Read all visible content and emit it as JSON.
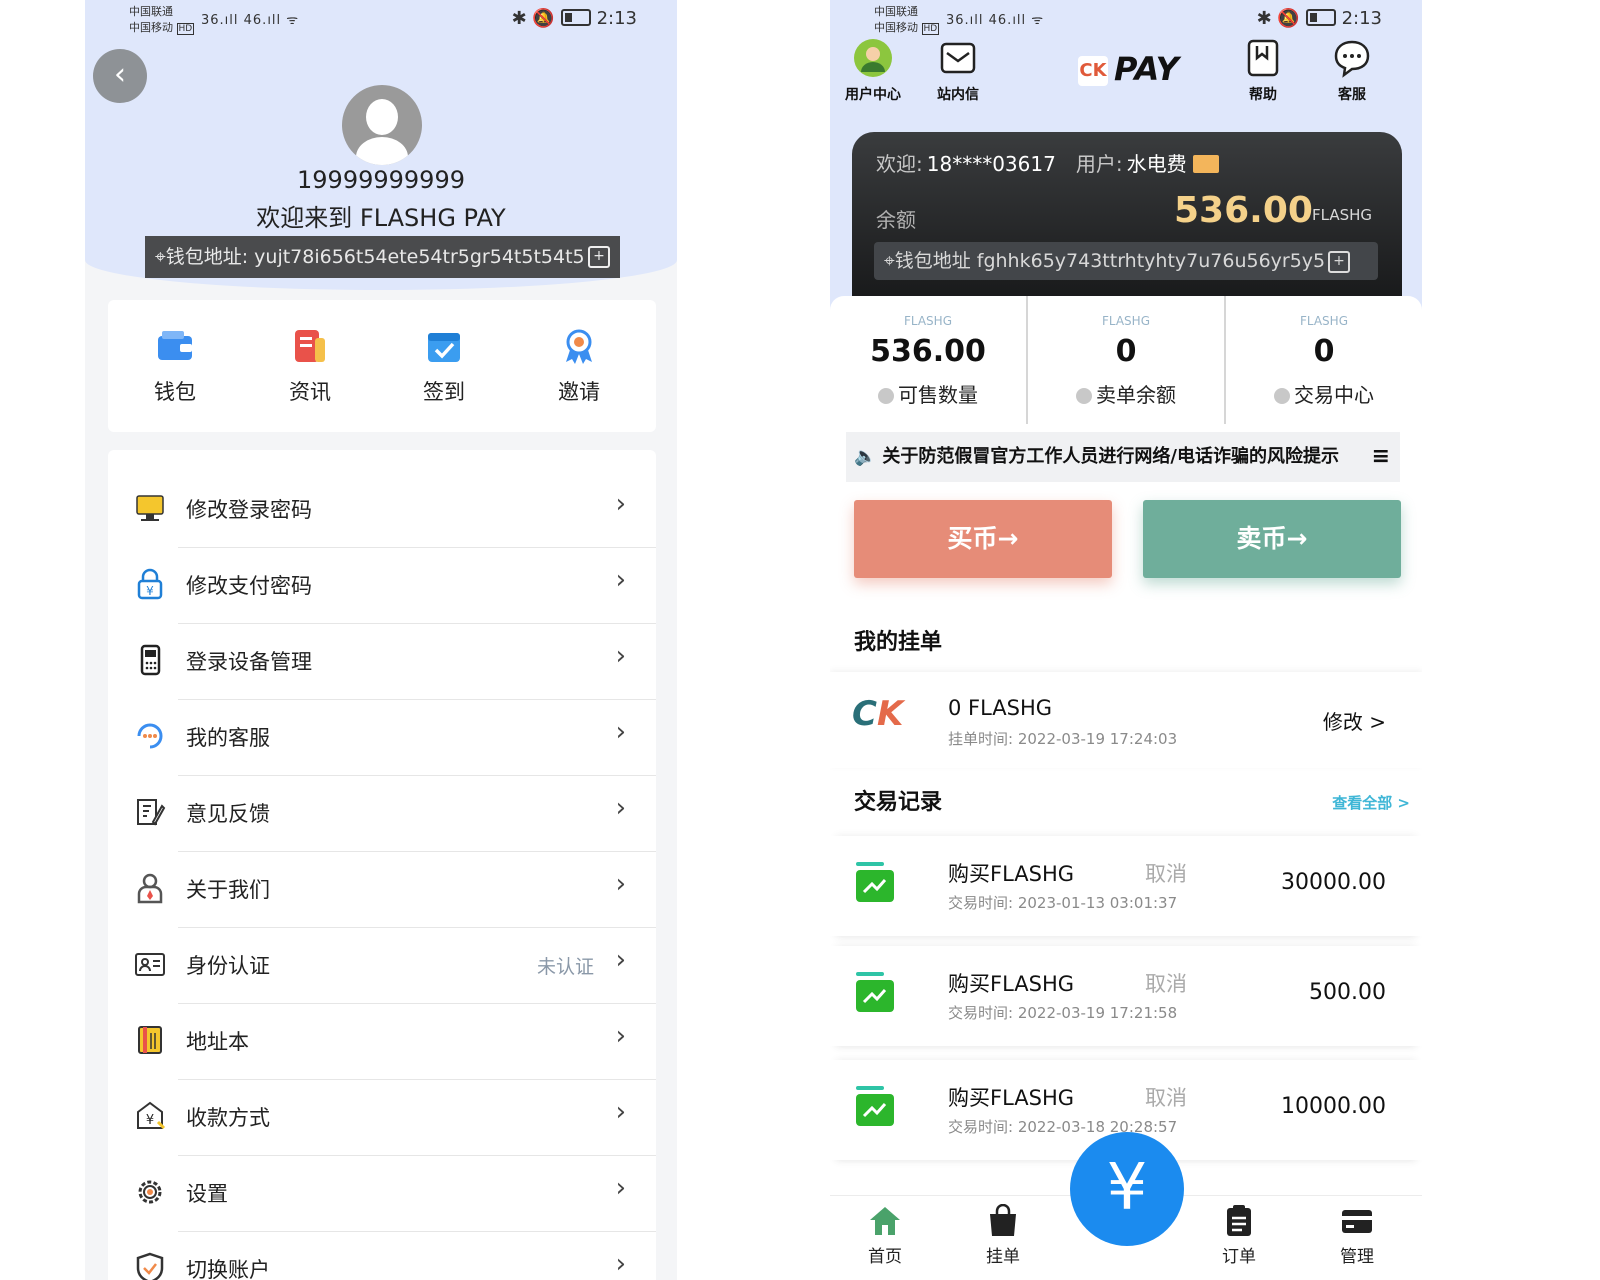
{
  "status_bar": {
    "carrier1": "中国联通",
    "carrier2": "中国移动",
    "hd": "HD",
    "signal": "36.ıll 46.ıll ᯤ",
    "time": "2:13"
  },
  "profile": {
    "phone": "19999999999",
    "welcome": "欢迎来到 FLASHG PAY",
    "wallet_label": "钱包地址:",
    "wallet_address": "yujt78i656t54ete54tr5gr54t5t54t5"
  },
  "quick_actions": [
    {
      "label": "钱包",
      "icon": "wallet-icon"
    },
    {
      "label": "资讯",
      "icon": "news-icon"
    },
    {
      "label": "签到",
      "icon": "checkin-icon"
    },
    {
      "label": "邀请",
      "icon": "invite-icon"
    }
  ],
  "menu": [
    {
      "label": "修改登录密码",
      "icon": "login-password-icon"
    },
    {
      "label": "修改支付密码",
      "icon": "pay-password-icon"
    },
    {
      "label": "登录设备管理",
      "icon": "device-icon"
    },
    {
      "label": "我的客服",
      "icon": "customer-service-icon"
    },
    {
      "label": "意见反馈",
      "icon": "feedback-icon"
    },
    {
      "label": "关于我们",
      "icon": "about-icon"
    },
    {
      "label": "身份认证",
      "icon": "id-card-icon",
      "extra": "未认证"
    },
    {
      "label": "地址本",
      "icon": "address-book-icon"
    },
    {
      "label": "收款方式",
      "icon": "payment-method-icon"
    },
    {
      "label": "设置",
      "icon": "settings-icon"
    },
    {
      "label": "切换账户",
      "icon": "switch-account-icon"
    }
  ],
  "home": {
    "nav": {
      "user_center": "用户中心",
      "inbox": "站内信",
      "help": "帮助",
      "service": "客服"
    },
    "logo_text": "PAY",
    "logo_mark": "CK",
    "welcome_label": "欢迎:",
    "welcome_value": "18****03617",
    "user_label": "用户:",
    "user_value": "水电费",
    "balance_label": "余额",
    "balance": "536.00",
    "unit": "FLASHG",
    "wallet_label": "钱包地址",
    "wallet_address": "fghhk65y743ttrhtyhty7u76u56yr5y5",
    "stats": [
      {
        "unit": "FLASHG",
        "value": "536.00",
        "label": "可售数量"
      },
      {
        "unit": "FLASHG",
        "value": "0",
        "label": "卖单余额"
      },
      {
        "unit": "FLASHG",
        "value": "0",
        "label": "交易中心"
      }
    ],
    "notice": "关于防范假冒官方工作人员进行网络/电话诈骗的风险提示",
    "buy_label": "买币→",
    "sell_label": "卖币→",
    "my_orders_title": "我的挂单",
    "order": {
      "amount": "0 FLASHG",
      "time": "挂单时间: 2022-03-19 17:24:03",
      "action": "修改 >"
    },
    "tx_title": "交易记录",
    "view_all": "查看全部 >",
    "transactions": [
      {
        "title": "购买FLASHG",
        "status": "取消",
        "time": "交易时间: 2023-01-13 03:01:37",
        "amount": "30000.00"
      },
      {
        "title": "购买FLASHG",
        "status": "取消",
        "time": "交易时间: 2022-03-19 17:21:58",
        "amount": "500.00"
      },
      {
        "title": "购买FLASHG",
        "status": "取消",
        "time": "交易时间: 2022-03-18 20:28:57",
        "amount": "10000.00"
      }
    ],
    "tabs": {
      "home": "首页",
      "orders_listed": "挂单",
      "fab": "¥",
      "orders": "订单",
      "manage": "管理"
    }
  },
  "colors": {
    "header_bg": "#dfe7fb",
    "buy": "#e68c78",
    "sell": "#6fae9b",
    "fab": "#1b8bef",
    "gold": "#f4d18a",
    "link": "#3fb6d6"
  }
}
